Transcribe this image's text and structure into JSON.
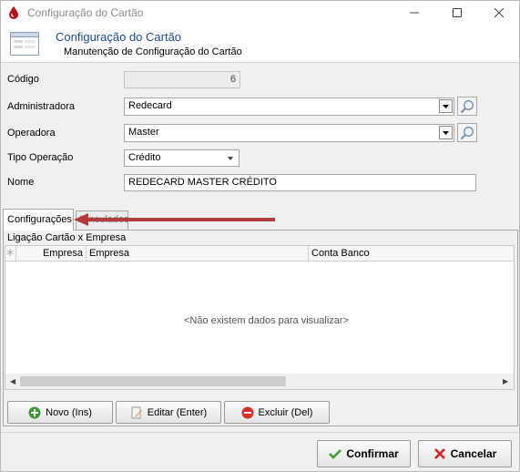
{
  "window": {
    "title": "Configuração do Cartão",
    "controls": [
      "minimize",
      "maximize",
      "close"
    ]
  },
  "header": {
    "title": "Configuração do Cartão",
    "subtitle": "Manutenção de Configuração do Cartão",
    "icon": "form-window-icon"
  },
  "form": {
    "codigo": {
      "label": "Código",
      "value": "6"
    },
    "administradora": {
      "label": "Administradora",
      "value": "Redecard"
    },
    "operadora": {
      "label": "Operadora",
      "value": "Master"
    },
    "tipo_operacao": {
      "label": "Tipo Operação",
      "value": "Crédito"
    },
    "nome": {
      "label": "Nome",
      "value": "REDECARD MASTER CRÉDITO"
    }
  },
  "tabs": [
    {
      "label": "Configurações",
      "active": true
    },
    {
      "label": "Vinculados",
      "active": false
    }
  ],
  "panel": {
    "group_caption": "Ligação Cartão x Empresa",
    "columns": [
      "Empresa",
      "Empresa",
      "Conta Banco"
    ],
    "rows": [],
    "empty_message": "<Não existem dados para visualizar>"
  },
  "actions": {
    "novo": "Novo (Ins)",
    "editar": "Editar (Enter)",
    "excluir": "Excluir (Del)"
  },
  "footer": {
    "confirmar": "Confirmar",
    "cancelar": "Cancelar"
  },
  "colors": {
    "header_title": "#1c4c8a",
    "annotation_arrow": "#b23b3b",
    "confirm_check": "#3aa12f",
    "cancel_x": "#d22222"
  }
}
